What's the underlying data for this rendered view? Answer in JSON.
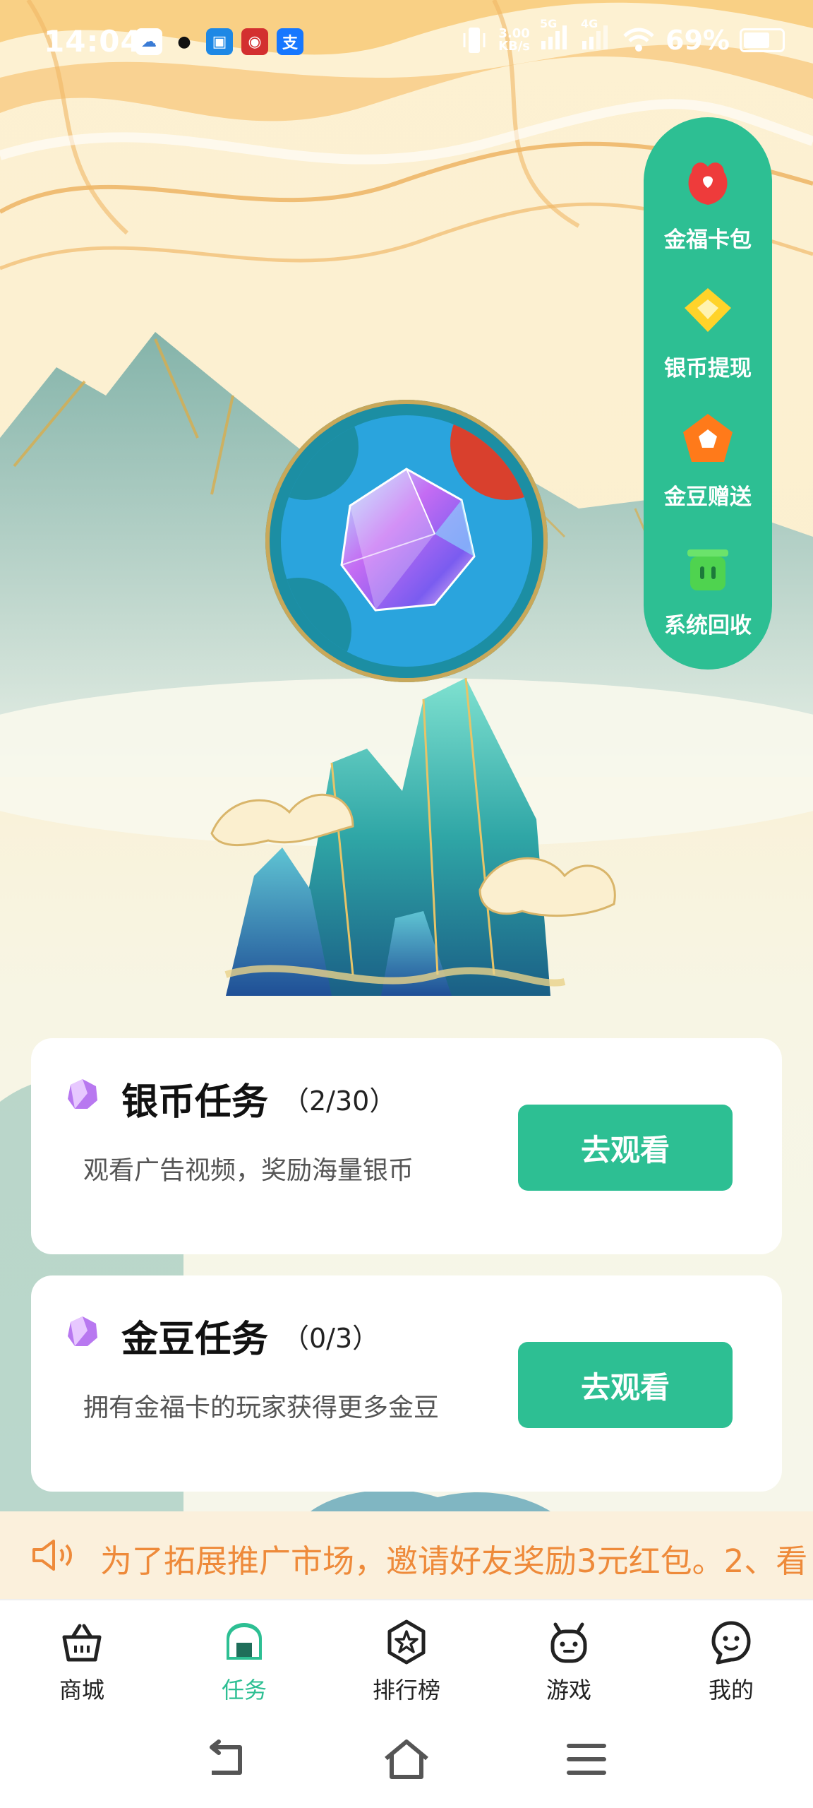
{
  "status_bar": {
    "time": "14:04",
    "net_speed_top": "3.00",
    "net_speed_bottom": "KB/s",
    "signal_label_1": "5G",
    "signal_label_2": "4G",
    "battery": "69%",
    "battery_level": 0.69
  },
  "side_menu": {
    "items": [
      {
        "label": "金福卡包",
        "icon": "red-pouch-icon"
      },
      {
        "label": "银币提现",
        "icon": "yellow-diamond-icon"
      },
      {
        "label": "金豆赠送",
        "icon": "orange-pentagon-icon"
      },
      {
        "label": "系统回收",
        "icon": "green-trash-icon"
      }
    ]
  },
  "tasks": [
    {
      "title": "银币任务",
      "progress": "（2/30）",
      "desc": "观看广告视频，奖励海量银币",
      "button": "去观看"
    },
    {
      "title": "金豆任务",
      "progress": "（0/3）",
      "desc": "拥有金福卡的玩家获得更多金豆",
      "button": "去观看"
    }
  ],
  "marquee": {
    "text": "为了拓展推广市场，邀请好友奖励3元红包。2、看"
  },
  "bottom_nav": {
    "items": [
      {
        "label": "商城",
        "icon": "basket-icon"
      },
      {
        "label": "任务",
        "icon": "task-house-icon"
      },
      {
        "label": "排行榜",
        "icon": "star-badge-icon"
      },
      {
        "label": "游戏",
        "icon": "game-robot-icon"
      },
      {
        "label": "我的",
        "icon": "profile-face-icon"
      }
    ],
    "active_index": 1
  },
  "colors": {
    "accent": "#2dbf93",
    "marquee_text": "#ee8a3a"
  }
}
